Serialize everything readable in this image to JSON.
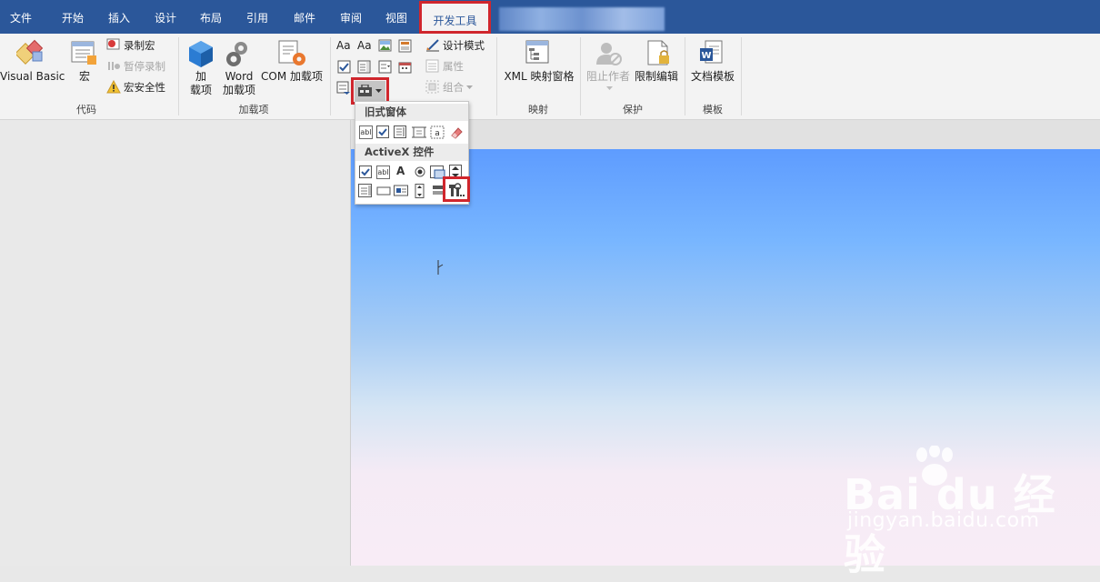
{
  "tabs": [
    "文件",
    "开始",
    "插入",
    "设计",
    "布局",
    "引用",
    "邮件",
    "审阅",
    "视图",
    "开发工具"
  ],
  "active_tab": "开发工具",
  "ribbon": {
    "code": {
      "visual_basic": "Visual Basic",
      "macros": "宏",
      "record_macro": "录制宏",
      "pause_recording": "暂停录制",
      "macro_security": "宏安全性",
      "label": "代码"
    },
    "addins": {
      "addins_line1": "加",
      "addins_line2": "载项",
      "word_line1": "Word",
      "word_line2": "加载项",
      "com": "COM 加载项",
      "label": "加载项"
    },
    "controls": {
      "design_mode": "设计模式",
      "properties": "属性",
      "group": "组合"
    },
    "mapping": {
      "xml_pane": "XML 映射窗格",
      "label": "映射"
    },
    "protect": {
      "block_authors": "阻止作者",
      "restrict_editing": "限制编辑",
      "label": "保护"
    },
    "templates": {
      "document_template": "文档模板",
      "label": "模板"
    }
  },
  "dropdown": {
    "legacy_header": "旧式窗体",
    "activex_header": "ActiveX 控件",
    "legacy_text_field": "abl",
    "activex_text_box": "abl",
    "activex_label": "A"
  },
  "watermark": {
    "brand": "Bai du 经验",
    "url": "jingyan.baidu.com"
  },
  "colors": {
    "title_bar": "#2b579a",
    "highlight": "#d0262d",
    "ribbon": "#f3f3f3"
  }
}
